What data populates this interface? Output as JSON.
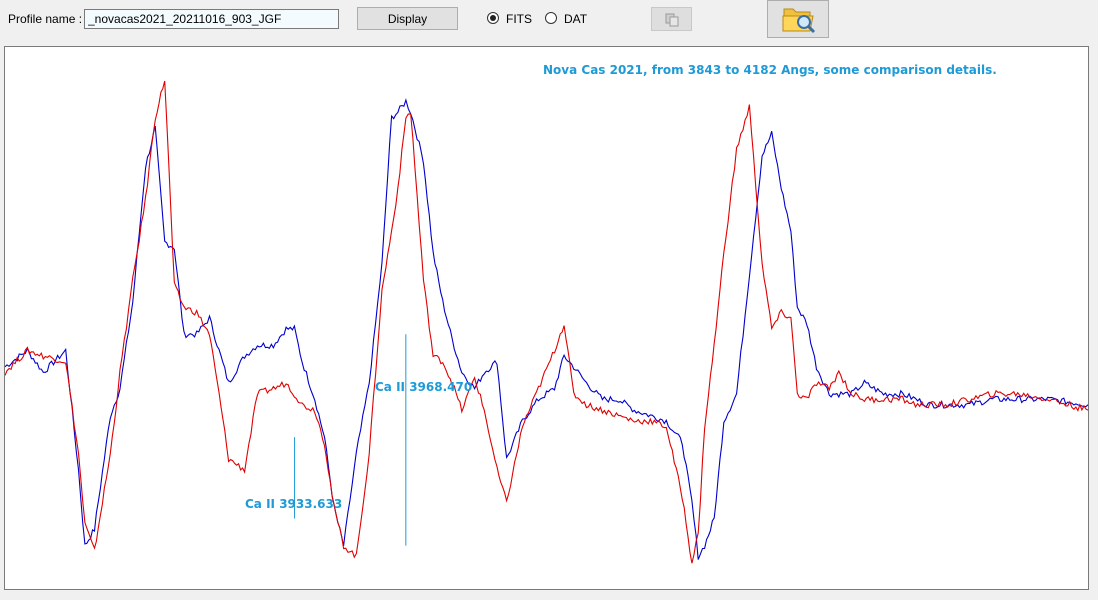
{
  "toolbar": {
    "profile_label": "Profile name :",
    "profile_value": "_novacas2021_20211016_903_JGF",
    "display_label": "Display",
    "format_options": [
      "FITS",
      "DAT"
    ],
    "selected_format": "FITS",
    "copy_icon": "copy-icon",
    "open_icon": "folder-search-icon"
  },
  "plot": {
    "title": "Nova Cas 2021, from 3843 to 4182 Angs,  some comparison details.",
    "annotations": [
      {
        "text": "Ca II  3933.633"
      },
      {
        "text": "Ca II 3968.470"
      }
    ],
    "colors": {
      "series_1": "#0000cc",
      "series_2": "#e00000",
      "annotation": "#1e9ad6"
    }
  },
  "chart_data": {
    "type": "line",
    "xlim": [
      3843,
      4182
    ],
    "x_unit": "Angstrom",
    "grid": false,
    "legend": "none",
    "title": "Nova Cas 2021, from 3843 to 4182 Angs,  some comparison details.",
    "annotations": [
      {
        "text": "Ca II  3933.633",
        "x": 3933.633
      },
      {
        "text": "Ca II 3968.470",
        "x": 3968.47
      }
    ],
    "x": [
      3843,
      3850,
      3855,
      3862,
      3866,
      3868,
      3871,
      3876,
      3879,
      3883,
      3887,
      3890,
      3893,
      3896,
      3899,
      3903,
      3907,
      3910,
      3913,
      3918,
      3922,
      3927,
      3931,
      3933.6,
      3936,
      3940,
      3943,
      3946,
      3949,
      3953,
      3957,
      3961,
      3964,
      3966,
      3968.5,
      3970,
      3974,
      3977,
      3980,
      3983,
      3986,
      3990,
      3993,
      3997,
      4000,
      4005,
      4010,
      4015,
      4018,
      4021,
      4025,
      4030,
      4035,
      4040,
      4045,
      4050,
      4055,
      4058,
      4060,
      4062,
      4065,
      4068,
      4072,
      4076,
      4080,
      4083,
      4086,
      4089,
      4091,
      4094,
      4097,
      4101,
      4104,
      4108,
      4112,
      4118,
      4124,
      4128,
      4132,
      4138,
      4145,
      4152,
      4160,
      4170,
      4182
    ],
    "series": [
      {
        "color": "#0000cc",
        "values": [
          0.41,
          0.44,
          0.4,
          0.44,
          0.22,
          0.08,
          0.11,
          0.32,
          0.37,
          0.53,
          0.78,
          0.85,
          0.64,
          0.63,
          0.47,
          0.47,
          0.5,
          0.44,
          0.38,
          0.43,
          0.45,
          0.45,
          0.48,
          0.48,
          0.42,
          0.35,
          0.28,
          0.15,
          0.08,
          0.25,
          0.38,
          0.6,
          0.87,
          0.88,
          0.9,
          0.88,
          0.79,
          0.62,
          0.53,
          0.46,
          0.4,
          0.37,
          0.4,
          0.42,
          0.24,
          0.31,
          0.35,
          0.37,
          0.43,
          0.41,
          0.38,
          0.35,
          0.35,
          0.33,
          0.32,
          0.31,
          0.27,
          0.16,
          0.06,
          0.08,
          0.13,
          0.31,
          0.36,
          0.58,
          0.8,
          0.84,
          0.74,
          0.66,
          0.52,
          0.49,
          0.41,
          0.36,
          0.36,
          0.36,
          0.38,
          0.36,
          0.36,
          0.35,
          0.34,
          0.34,
          0.34,
          0.35,
          0.35,
          0.35,
          0.34
        ]
      },
      {
        "color": "#e00000",
        "values": [
          0.4,
          0.44,
          0.43,
          0.42,
          0.25,
          0.12,
          0.07,
          0.25,
          0.4,
          0.57,
          0.72,
          0.87,
          0.94,
          0.56,
          0.52,
          0.51,
          0.47,
          0.36,
          0.24,
          0.22,
          0.36,
          0.37,
          0.38,
          0.36,
          0.34,
          0.33,
          0.27,
          0.15,
          0.08,
          0.06,
          0.25,
          0.55,
          0.66,
          0.74,
          0.87,
          0.88,
          0.57,
          0.43,
          0.42,
          0.38,
          0.33,
          0.39,
          0.33,
          0.22,
          0.16,
          0.3,
          0.37,
          0.44,
          0.49,
          0.36,
          0.34,
          0.33,
          0.32,
          0.31,
          0.31,
          0.3,
          0.17,
          0.05,
          0.1,
          0.3,
          0.45,
          0.62,
          0.81,
          0.89,
          0.6,
          0.48,
          0.51,
          0.5,
          0.36,
          0.35,
          0.38,
          0.37,
          0.4,
          0.36,
          0.35,
          0.35,
          0.35,
          0.34,
          0.34,
          0.34,
          0.35,
          0.36,
          0.36,
          0.35,
          0.33
        ]
      }
    ]
  }
}
